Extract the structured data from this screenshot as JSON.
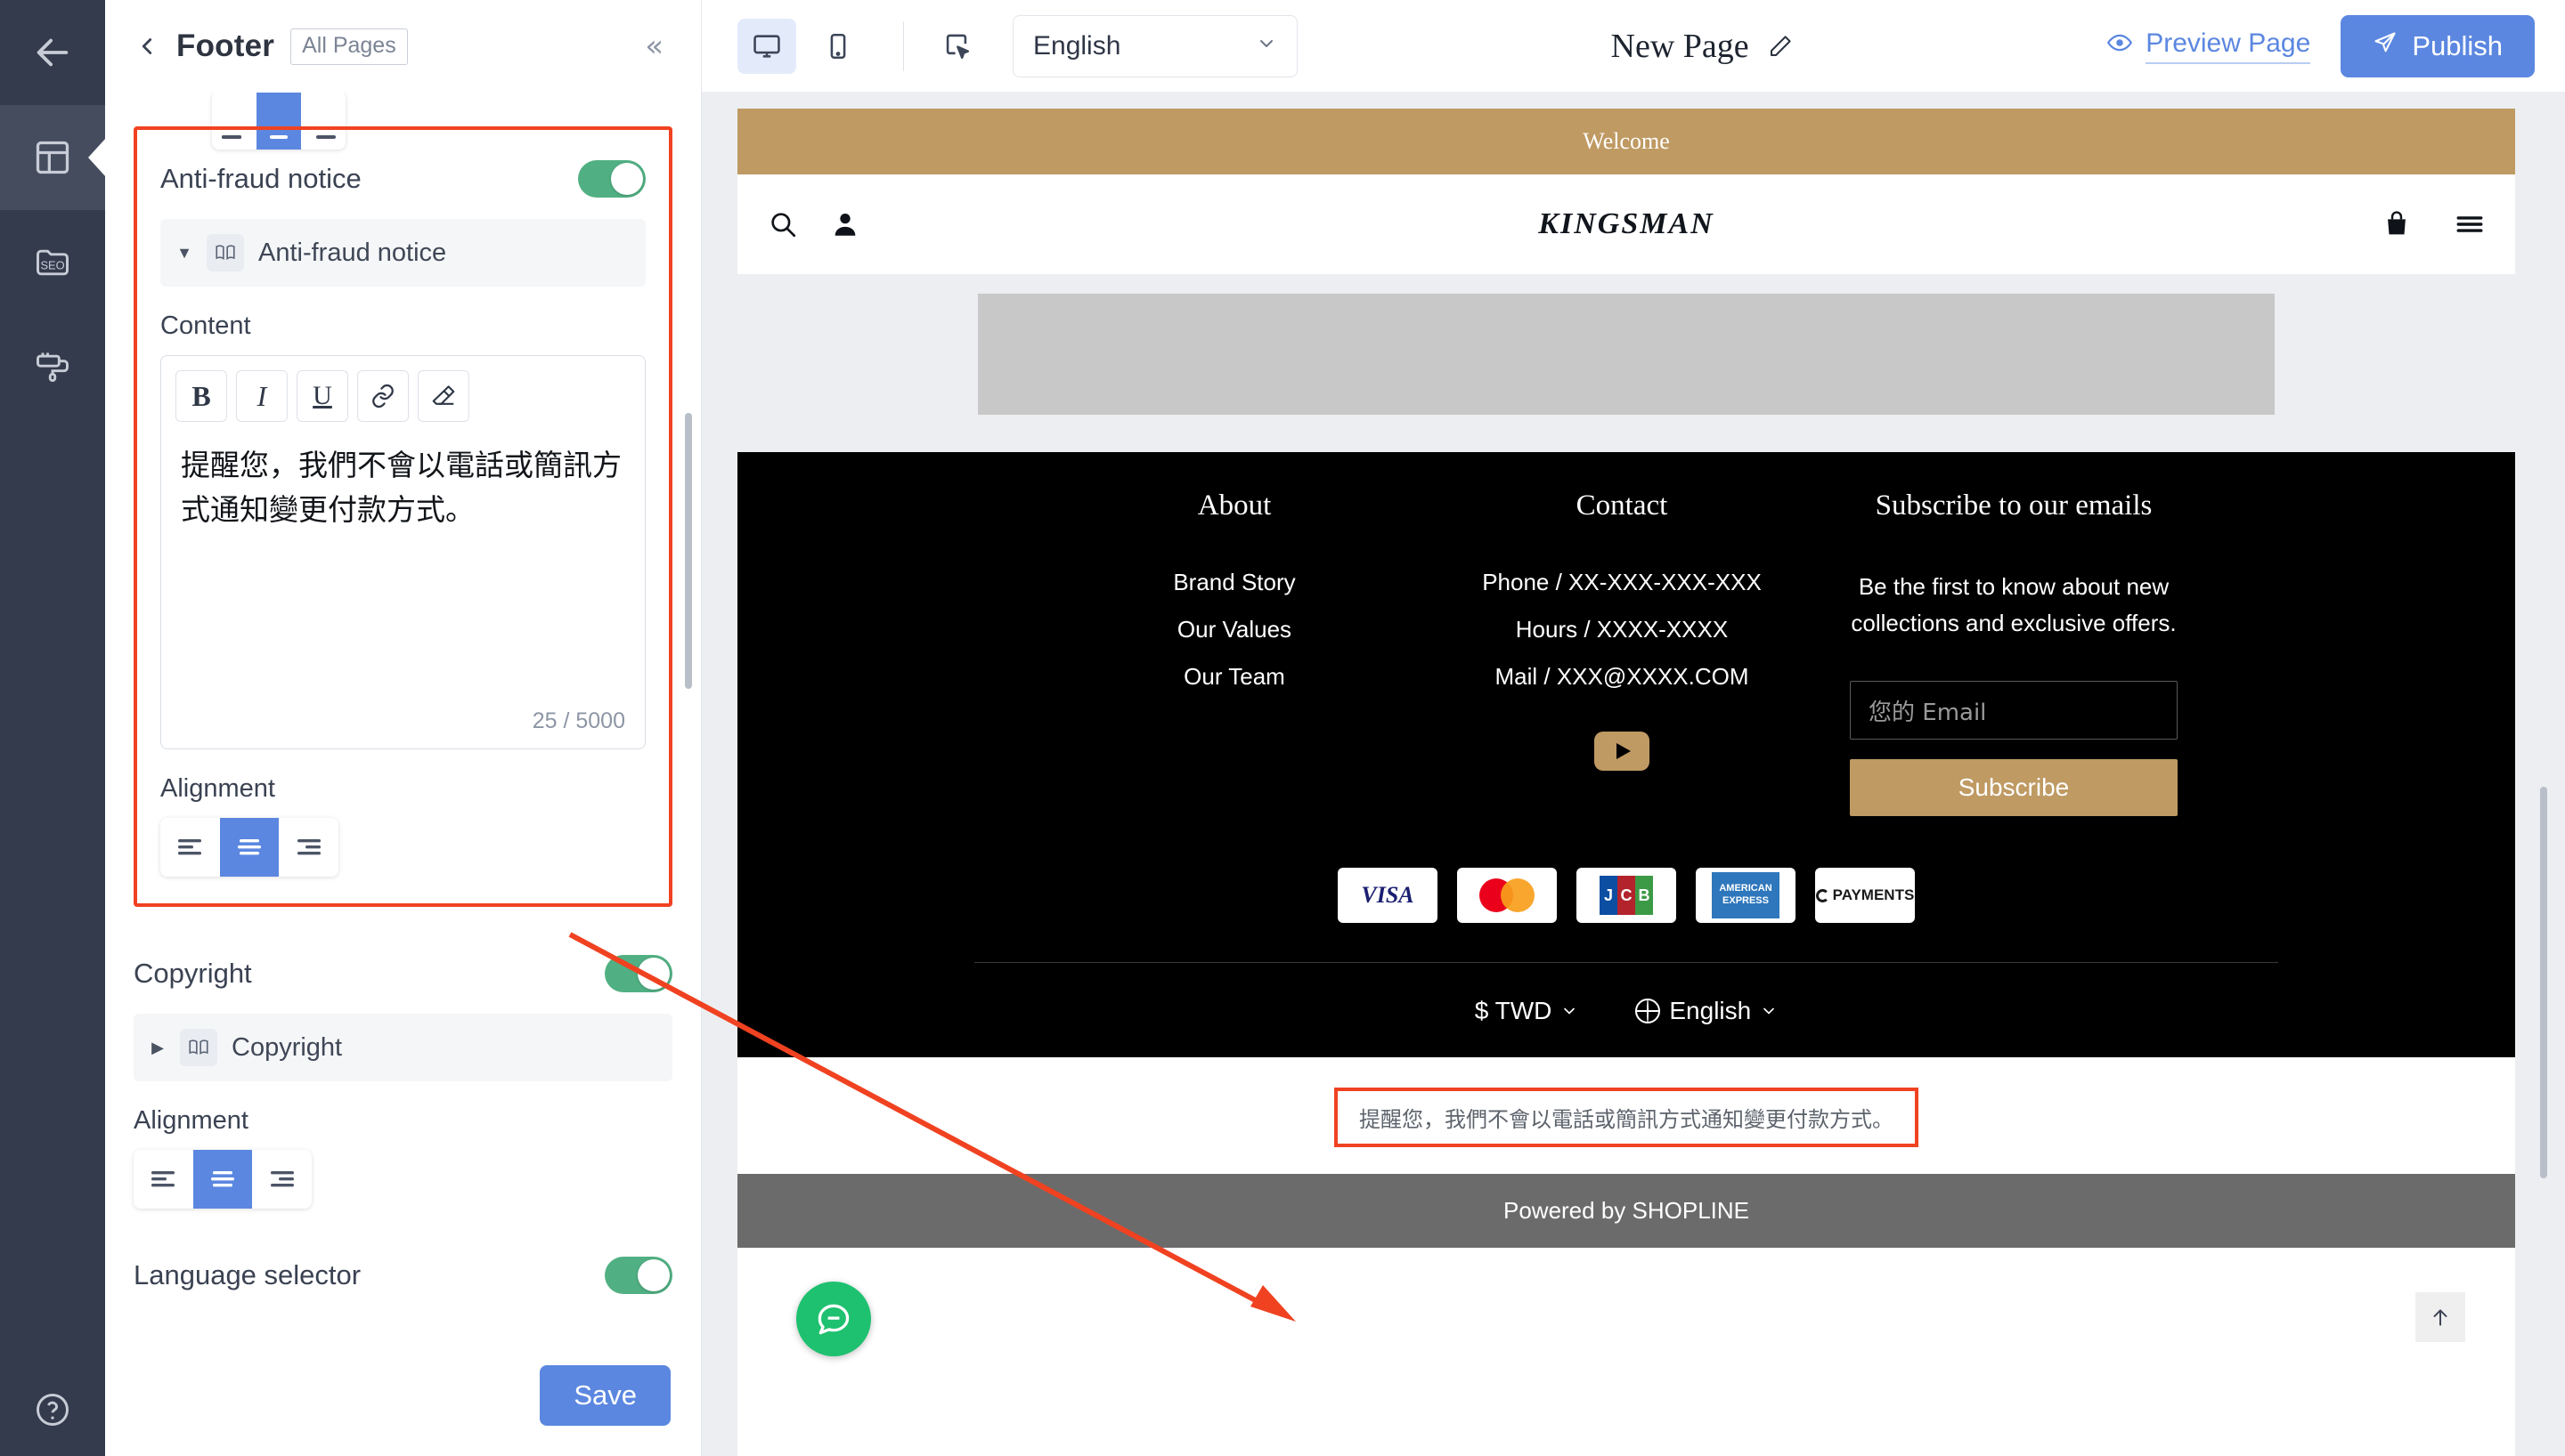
{
  "rail": {
    "items": [
      {
        "name": "back-arrow-icon",
        "label": "Back"
      },
      {
        "name": "layout-icon",
        "label": "Design"
      },
      {
        "name": "seo-icon",
        "label": "SEO"
      },
      {
        "name": "theme-icon",
        "label": "Theme"
      }
    ],
    "help_label": "Help"
  },
  "panel": {
    "title": "Footer",
    "badge": "All Pages",
    "collapse_icon": "«",
    "antifraud": {
      "label": "Anti-fraud notice",
      "toggle_on": true,
      "block_label": "Anti-fraud notice",
      "content_label": "Content",
      "toolbar": {
        "bold": "B",
        "italic": "I",
        "underline": "U",
        "link": "link-icon",
        "clear_format": "eraser-icon"
      },
      "content_text": "提醒您，我們不會以電話或簡訊方式通知變更付款方式。",
      "counter": "25 / 5000",
      "alignment_label": "Alignment",
      "alignment_selected": "center"
    },
    "copyright": {
      "label": "Copyright",
      "toggle_on": true,
      "block_label": "Copyright",
      "alignment_label": "Alignment",
      "alignment_selected": "center"
    },
    "language_selector": {
      "label": "Language selector",
      "toggle_on": true
    },
    "save_label": "Save"
  },
  "topbar": {
    "device_desktop": "desktop-icon",
    "device_mobile": "mobile-icon",
    "select_tool": "select-tool-icon",
    "language_value": "English",
    "page_title": "New Page",
    "edit_icon": "pencil-icon",
    "preview_label": "Preview Page",
    "publish_label": "Publish"
  },
  "preview": {
    "welcome_bar": "Welcome",
    "store_logo": "KINGSMAN",
    "header_icons": [
      "search-icon",
      "account-icon",
      "cart-icon",
      "menu-icon"
    ],
    "footer": {
      "about": {
        "heading": "About",
        "links": [
          "Brand Story",
          "Our Values",
          "Our Team"
        ]
      },
      "contact": {
        "heading": "Contact",
        "links": [
          "Phone / XX-XXX-XXX-XXX",
          "Hours / XXXX-XXXX",
          "Mail / XXX@XXXX.COM"
        ],
        "social": "youtube-icon"
      },
      "subscribe": {
        "heading": "Subscribe to our emails",
        "description": "Be the first to know about new collections and exclusive offers.",
        "email_placeholder": "您的 Email",
        "button_label": "Subscribe"
      },
      "payments": [
        {
          "name": "visa",
          "label": "VISA"
        },
        {
          "name": "mastercard",
          "label": ""
        },
        {
          "name": "jcb",
          "label": "JCB"
        },
        {
          "name": "amex",
          "label": "AMERICAN EXPRESS"
        },
        {
          "name": "payments",
          "label": "PAYMENTS"
        }
      ],
      "currency_selector": "$ TWD",
      "language_selector": "English",
      "antifraud_notice": "提醒您，我們不會以電話或簡訊方式通知變更付款方式。",
      "powered_by": "Powered by SHOPLINE"
    },
    "chat_widget": "chat-icon",
    "scroll_top": "arrow-up-icon"
  },
  "colors": {
    "accent_blue": "#5b87e0",
    "toggle_green": "#51b083",
    "highlight_red": "#f04221",
    "brand_gold": "#bf9a63",
    "rail_dark": "#343b4c"
  }
}
